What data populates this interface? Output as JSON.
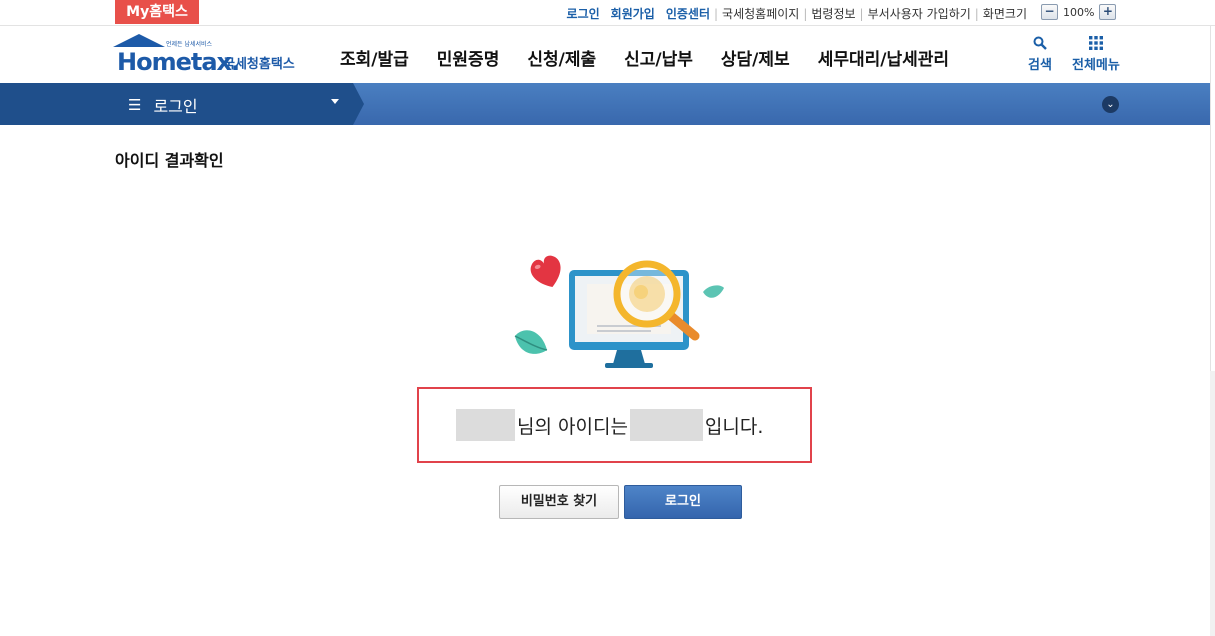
{
  "topbar": {
    "my_label": "My홈택스",
    "links": [
      "로그인",
      "회원가입",
      "인증센터"
    ],
    "sublinks": [
      "국세청홈페이지",
      "법령정보",
      "부서사용자 가입하기",
      "화면크기"
    ],
    "zoom_minus": "−",
    "zoom_value": "100%",
    "zoom_plus": "+"
  },
  "header": {
    "logo_home": "Hometax.",
    "logo_ko": "국세청홈택스",
    "logo_tag": "언제든 납세서비스",
    "menu": [
      "조회/발급",
      "민원증명",
      "신청/제출",
      "신고/납부",
      "상담/제보",
      "세무대리/납세관리"
    ],
    "search_label": "검색",
    "allmenu_label": "전체메뉴"
  },
  "subnav": {
    "current": "로그인"
  },
  "page": {
    "title": "아이디 결과확인",
    "result_mid": "님의 아이디는",
    "result_end": "입니다.",
    "find_password_label": "비밀번호 찾기",
    "login_label": "로그인"
  },
  "colors": {
    "brand": "#1d5aa8",
    "accent_red": "#e1434b",
    "nav_blue": "#3968ad"
  }
}
